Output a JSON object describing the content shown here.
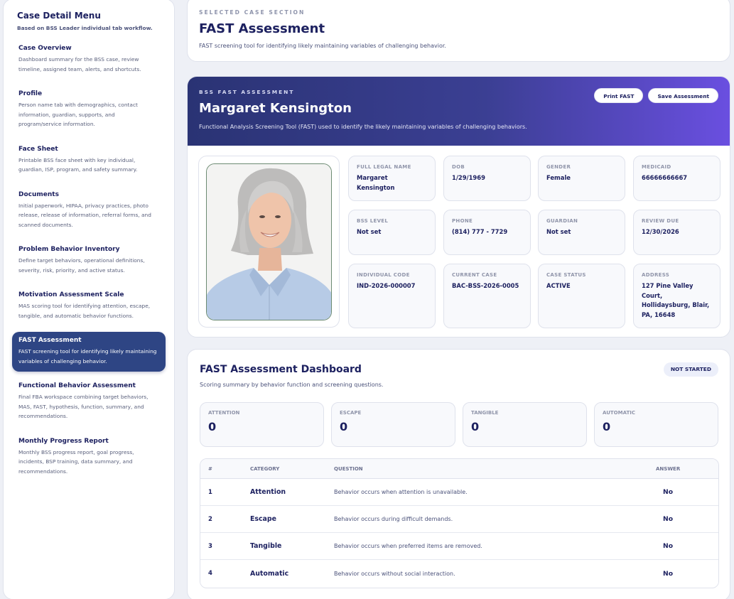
{
  "sidebar": {
    "title": "Case Detail Menu",
    "subtitle": "Based on BSS Leader individual tab workflow.",
    "items": [
      {
        "label": "Case Overview",
        "desc": "Dashboard summary for the BSS case, review timeline, assigned team, alerts, and shortcuts.",
        "active": false
      },
      {
        "label": "Profile",
        "desc": "Person name tab with demographics, contact information, guardian, supports, and program/service information.",
        "active": false
      },
      {
        "label": "Face Sheet",
        "desc": "Printable BSS face sheet with key individual, guardian, ISP, program, and safety summary.",
        "active": false
      },
      {
        "label": "Documents",
        "desc": "Initial paperwork, HIPAA, privacy practices, photo release, release of information, referral forms, and scanned documents.",
        "active": false
      },
      {
        "label": "Problem Behavior Inventory",
        "desc": "Define target behaviors, operational definitions, severity, risk, priority, and active status.",
        "active": false
      },
      {
        "label": "Motivation Assessment Scale",
        "desc": "MAS scoring tool for identifying attention, escape, tangible, and automatic behavior functions.",
        "active": false
      },
      {
        "label": "FAST Assessment",
        "desc": "FAST screening tool for identifying likely maintaining variables of challenging behavior.",
        "active": true
      },
      {
        "label": "Functional Behavior Assessment",
        "desc": "Final FBA workspace combining target behaviors, MAS, FAST, hypothesis, function, summary, and recommendations.",
        "active": false
      },
      {
        "label": "Monthly Progress Report",
        "desc": "Monthly BSS progress report, goal progress, incidents, BSP training, data summary, and recommendations.",
        "active": false
      }
    ]
  },
  "section": {
    "eyebrow": "SELECTED CASE SECTION",
    "title": "FAST Assessment",
    "desc": "FAST screening tool for identifying likely maintaining variables of challenging behavior."
  },
  "banner": {
    "eyebrow": "BSS FAST ASSESSMENT",
    "name": "Margaret Kensington",
    "desc": "Functional Analysis Screening Tool (FAST) used to identify the likely maintaining variables of challenging behaviors.",
    "print_label": "Print FAST",
    "save_label": "Save Assessment"
  },
  "fields": [
    {
      "label": "FULL LEGAL NAME",
      "value": "Margaret Kensington"
    },
    {
      "label": "DOB",
      "value": "1/29/1969"
    },
    {
      "label": "GENDER",
      "value": "Female"
    },
    {
      "label": "MEDICAID",
      "value": "66666666667"
    },
    {
      "label": "BSS LEVEL",
      "value": "Not set"
    },
    {
      "label": "PHONE",
      "value": "(814) 777 - 7729"
    },
    {
      "label": "GUARDIAN",
      "value": "Not set"
    },
    {
      "label": "REVIEW DUE",
      "value": "12/30/2026"
    },
    {
      "label": "INDIVIDUAL CODE",
      "value": "IND-2026-000007"
    },
    {
      "label": "CURRENT CASE",
      "value": "BAC-BSS-2026-0005"
    },
    {
      "label": "CASE STATUS",
      "value": "ACTIVE"
    },
    {
      "label": "ADDRESS",
      "value": "127 Pine Valley Court, Hollidaysburg, Blair, PA, 16648"
    }
  ],
  "dashboard": {
    "title": "FAST Assessment Dashboard",
    "subtitle": "Scoring summary by behavior function and screening questions.",
    "status": "NOT STARTED",
    "scores": [
      {
        "label": "ATTENTION",
        "value": "0"
      },
      {
        "label": "ESCAPE",
        "value": "0"
      },
      {
        "label": "TANGIBLE",
        "value": "0"
      },
      {
        "label": "AUTOMATIC",
        "value": "0"
      }
    ],
    "columns": {
      "num": "#",
      "category": "CATEGORY",
      "question": "QUESTION",
      "answer": "ANSWER"
    },
    "rows": [
      {
        "num": "1",
        "category": "Attention",
        "question": "Behavior occurs when attention is unavailable.",
        "answer": "No"
      },
      {
        "num": "2",
        "category": "Escape",
        "question": "Behavior occurs during difficult demands.",
        "answer": "No"
      },
      {
        "num": "3",
        "category": "Tangible",
        "question": "Behavior occurs when preferred items are removed.",
        "answer": "No"
      },
      {
        "num": "4",
        "category": "Automatic",
        "question": "Behavior occurs without social interaction.",
        "answer": "No"
      }
    ]
  }
}
